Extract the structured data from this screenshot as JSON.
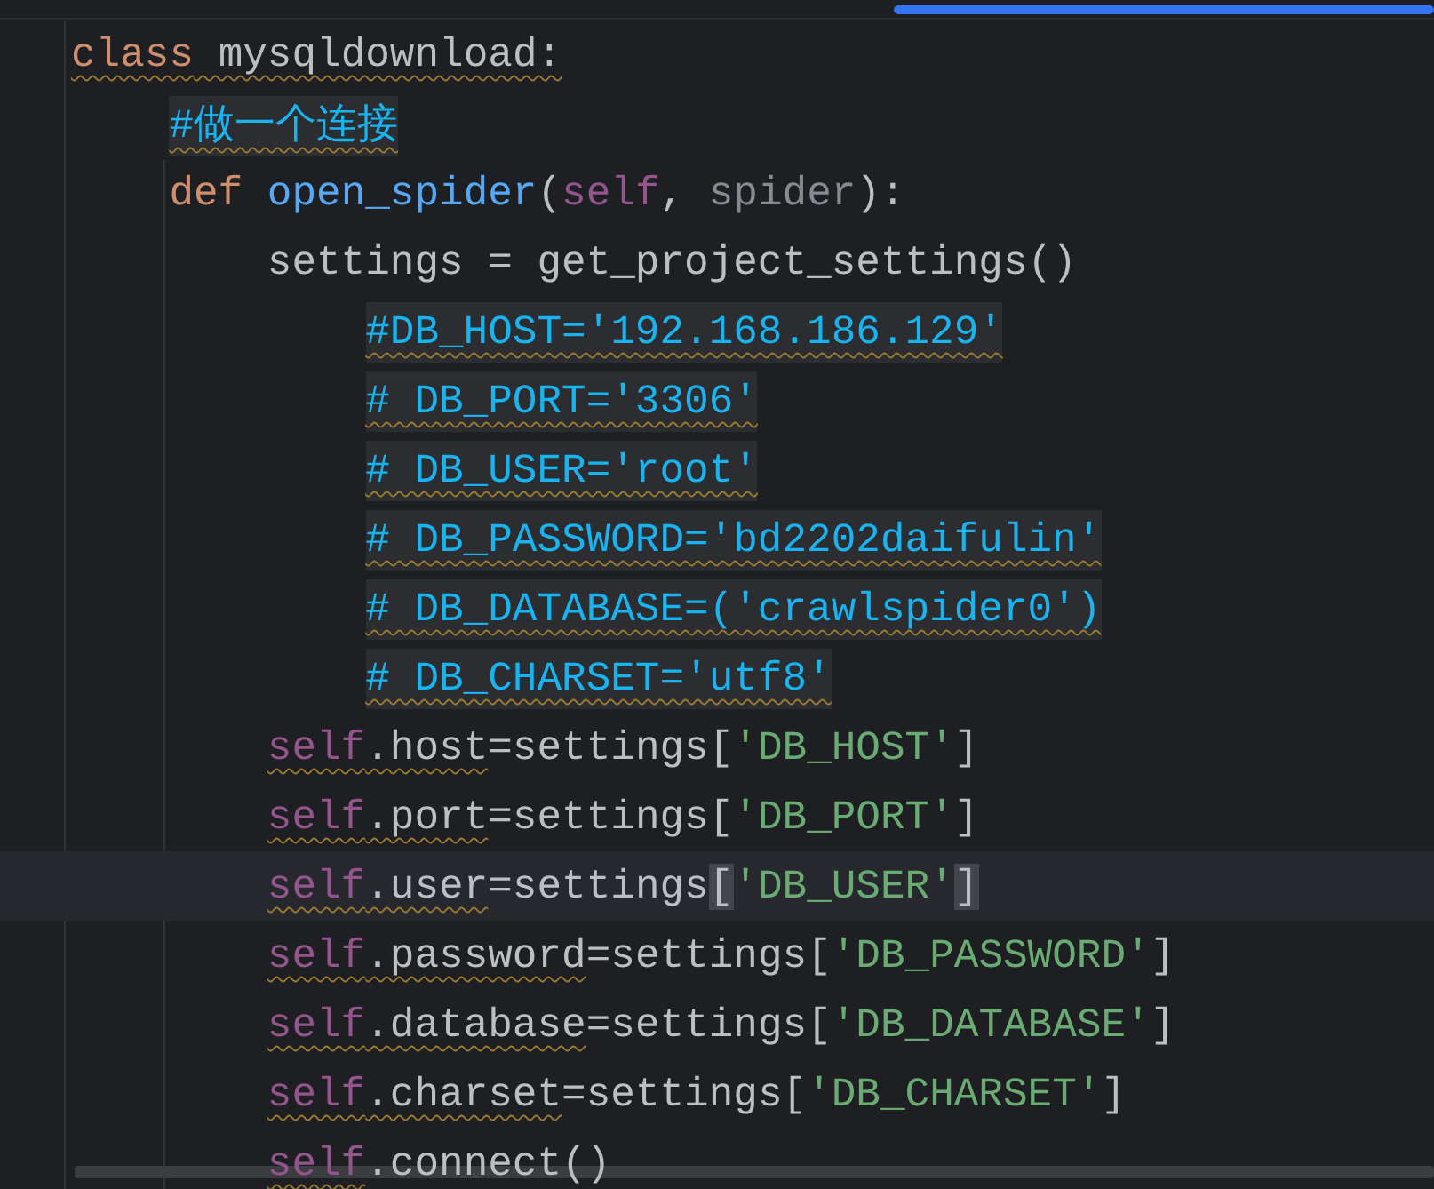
{
  "editor": {
    "lines": [
      {
        "current": false,
        "tokens": [
          {
            "kind": "keyword",
            "text": "class",
            "warning": true
          },
          {
            "kind": "text",
            "text": " mysqldownload:",
            "warning": true
          }
        ],
        "children": [
          {
            "current": false,
            "tokens": [
              {
                "kind": "comment",
                "text": "#做一个连接",
                "warning": true
              }
            ]
          },
          {
            "current": false,
            "tokens": [
              {
                "kind": "keyword",
                "text": "def "
              },
              {
                "kind": "function",
                "text": "open_spider"
              },
              {
                "kind": "text",
                "text": "("
              },
              {
                "kind": "self",
                "text": "self"
              },
              {
                "kind": "text",
                "text": ", "
              },
              {
                "kind": "unused",
                "text": "spider"
              },
              {
                "kind": "text",
                "text": "):"
              }
            ],
            "children": [
              {
                "current": false,
                "tokens": [
                  {
                    "kind": "text",
                    "text": "settings = get_project_settings()"
                  }
                ],
                "children": [
                  {
                    "current": false,
                    "tokens": [
                      {
                        "kind": "comment",
                        "text": "#DB_HOST='192.168.186.129'",
                        "warning": true
                      }
                    ]
                  },
                  {
                    "current": false,
                    "tokens": [
                      {
                        "kind": "comment",
                        "text": "# DB_PORT='3306'",
                        "warning": true
                      }
                    ]
                  },
                  {
                    "current": false,
                    "tokens": [
                      {
                        "kind": "comment",
                        "text": "# DB_USER='root'",
                        "warning": true
                      }
                    ]
                  },
                  {
                    "current": false,
                    "tokens": [
                      {
                        "kind": "comment",
                        "text": "# DB_PASSWORD='bd2202daifulin'",
                        "warning": true
                      }
                    ]
                  },
                  {
                    "current": false,
                    "tokens": [
                      {
                        "kind": "comment",
                        "text": "# DB_DATABASE=('crawlspider0')",
                        "warning": true
                      }
                    ]
                  },
                  {
                    "current": false,
                    "tokens": [
                      {
                        "kind": "comment",
                        "text": "# DB_CHARSET='utf8'",
                        "warning": true
                      }
                    ]
                  }
                ]
              },
              {
                "current": false,
                "tokens": [
                  {
                    "kind": "self",
                    "text": "self",
                    "warning": true
                  },
                  {
                    "kind": "text",
                    "text": ".host",
                    "warning": true
                  },
                  {
                    "kind": "text",
                    "text": "=settings["
                  },
                  {
                    "kind": "string",
                    "text": "'DB_HOST'"
                  },
                  {
                    "kind": "text",
                    "text": "]"
                  }
                ]
              },
              {
                "current": false,
                "tokens": [
                  {
                    "kind": "self",
                    "text": "self",
                    "warning": true
                  },
                  {
                    "kind": "text",
                    "text": ".port",
                    "warning": true
                  },
                  {
                    "kind": "text",
                    "text": "=settings["
                  },
                  {
                    "kind": "string",
                    "text": "'DB_PORT'"
                  },
                  {
                    "kind": "text",
                    "text": "]"
                  }
                ]
              },
              {
                "current": true,
                "tokens": [
                  {
                    "kind": "self",
                    "text": "self",
                    "warning": true
                  },
                  {
                    "kind": "text",
                    "text": ".user",
                    "warning": true
                  },
                  {
                    "kind": "text",
                    "text": "=settings"
                  },
                  {
                    "kind": "bracket-match",
                    "text": "["
                  },
                  {
                    "kind": "string",
                    "text": "'DB_USER'"
                  },
                  {
                    "kind": "bracket-match",
                    "text": "]"
                  }
                ]
              },
              {
                "current": false,
                "tokens": [
                  {
                    "kind": "self",
                    "text": "self",
                    "warning": true
                  },
                  {
                    "kind": "text",
                    "text": ".password",
                    "warning": true
                  },
                  {
                    "kind": "text",
                    "text": "=settings["
                  },
                  {
                    "kind": "string",
                    "text": "'DB_PASSWORD'"
                  },
                  {
                    "kind": "text",
                    "text": "]"
                  }
                ]
              },
              {
                "current": false,
                "tokens": [
                  {
                    "kind": "self",
                    "text": "self",
                    "warning": true
                  },
                  {
                    "kind": "text",
                    "text": ".database",
                    "warning": true
                  },
                  {
                    "kind": "text",
                    "text": "=settings["
                  },
                  {
                    "kind": "string",
                    "text": "'DB_DATABASE'"
                  },
                  {
                    "kind": "text",
                    "text": "]"
                  }
                ]
              },
              {
                "current": false,
                "tokens": [
                  {
                    "kind": "self",
                    "text": "self",
                    "warning": true
                  },
                  {
                    "kind": "text",
                    "text": ".charset",
                    "warning": true
                  },
                  {
                    "kind": "text",
                    "text": "=settings["
                  },
                  {
                    "kind": "string",
                    "text": "'DB_CHARSET'"
                  },
                  {
                    "kind": "text",
                    "text": "]"
                  }
                ]
              },
              {
                "current": false,
                "tokens": [
                  {
                    "kind": "self",
                    "text": "self",
                    "warning": true
                  },
                  {
                    "kind": "text",
                    "text": ".connect()"
                  }
                ]
              }
            ]
          }
        ]
      }
    ]
  }
}
